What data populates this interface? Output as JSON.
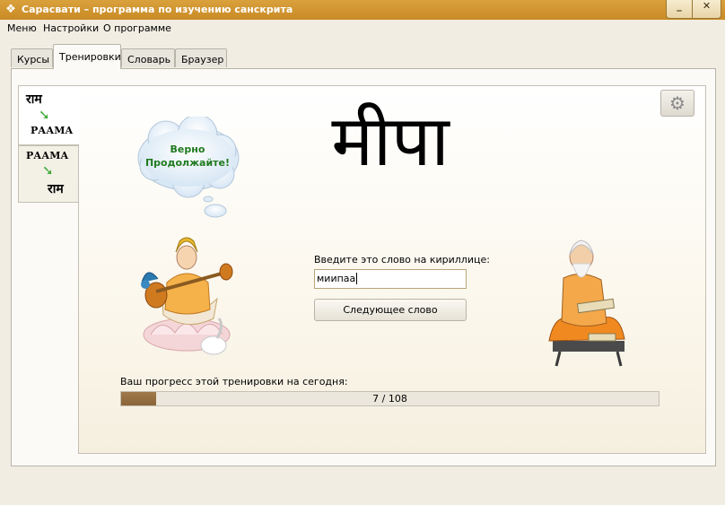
{
  "window": {
    "title": "Сарасвати – программа по изучению санскрита",
    "icon": "app-icon",
    "minimize": "_",
    "close": "✕"
  },
  "menu": [
    "Меню",
    "Настройки",
    "О программе"
  ],
  "tabs": [
    {
      "label": "Курсы",
      "active": false
    },
    {
      "label": "Тренировки",
      "active": true
    },
    {
      "label": "Словарь",
      "active": false
    },
    {
      "label": "Браузер",
      "active": false
    }
  ],
  "mode_tabs": [
    {
      "from": "राम",
      "to": "РААМА",
      "active": true
    },
    {
      "from": "РААМА",
      "to": "राम",
      "active": false
    }
  ],
  "feedback": {
    "line1": "Верно",
    "line2": "Продолжайте!"
  },
  "word": "मीपा",
  "prompt": "Введите это слово на кириллице:",
  "input_value": "миипаа",
  "next_button": "Следующее слово",
  "progress": {
    "label": "Ваш прогресс этой тренировки на сегодня:",
    "text": "7 / 108",
    "fraction": 0.0648
  },
  "icons": {
    "settings": "gear-icon",
    "mode_arrow": "green-down-right-arrow-icon"
  },
  "colors": {
    "titlebar": "#d09a34",
    "feedback_text": "#1f7a1f",
    "progress_fill": "#8a6438"
  }
}
